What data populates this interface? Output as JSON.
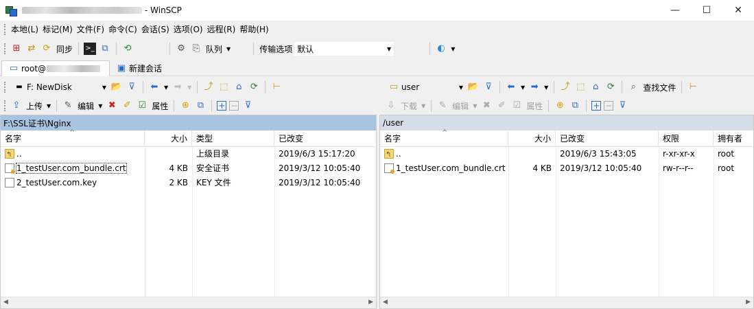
{
  "window": {
    "title": "- WinSCP",
    "minimize": "—",
    "maximize": "☐",
    "close": "✕"
  },
  "menu": [
    "本地(L)",
    "标记(M)",
    "文件(F)",
    "命令(C)",
    "会话(S)",
    "选项(O)",
    "远程(R)",
    "帮助(H)"
  ],
  "toolbar1": {
    "sync_label": "同步",
    "queue_label": "队列",
    "transfer_label": "传输选项",
    "transfer_value": "默认"
  },
  "tabs": {
    "session_label": "root@",
    "new_session_label": "新建会话"
  },
  "left": {
    "drive": "F: NewDisk",
    "upload_label": "上传",
    "edit_label": "编辑",
    "props_label": "属性",
    "path": "F:\\SSL证书\\Nginx",
    "columns": {
      "name": "名字",
      "size": "大小",
      "type": "类型",
      "changed": "已改变"
    },
    "rows": [
      {
        "name": "..",
        "size": "",
        "type": "上级目录",
        "changed": "2019/6/3  15:17:20"
      },
      {
        "name": "1_testUser.com_bundle.crt",
        "size": "4 KB",
        "type": "安全证书",
        "changed": "2019/3/12  10:05:40"
      },
      {
        "name": "2_testUser.com.key",
        "size": "2 KB",
        "type": "KEY 文件",
        "changed": "2019/3/12  10:05:40"
      }
    ]
  },
  "right": {
    "dir": "user",
    "find_label": "查找文件",
    "download_label": "下载",
    "edit_label": "编辑",
    "props_label": "属性",
    "path": "/user",
    "columns": {
      "name": "名字",
      "size": "大小",
      "changed": "已改变",
      "rights": "权限",
      "owner": "拥有者"
    },
    "rows": [
      {
        "name": "..",
        "size": "",
        "changed": "2019/6/3 15:43:05",
        "rights": "r-xr-xr-x",
        "owner": "root"
      },
      {
        "name": "1_testUser.com_bundle.crt",
        "size": "4 KB",
        "changed": "2019/3/12 10:05:40",
        "rights": "rw-r--r--",
        "owner": "root"
      }
    ]
  }
}
